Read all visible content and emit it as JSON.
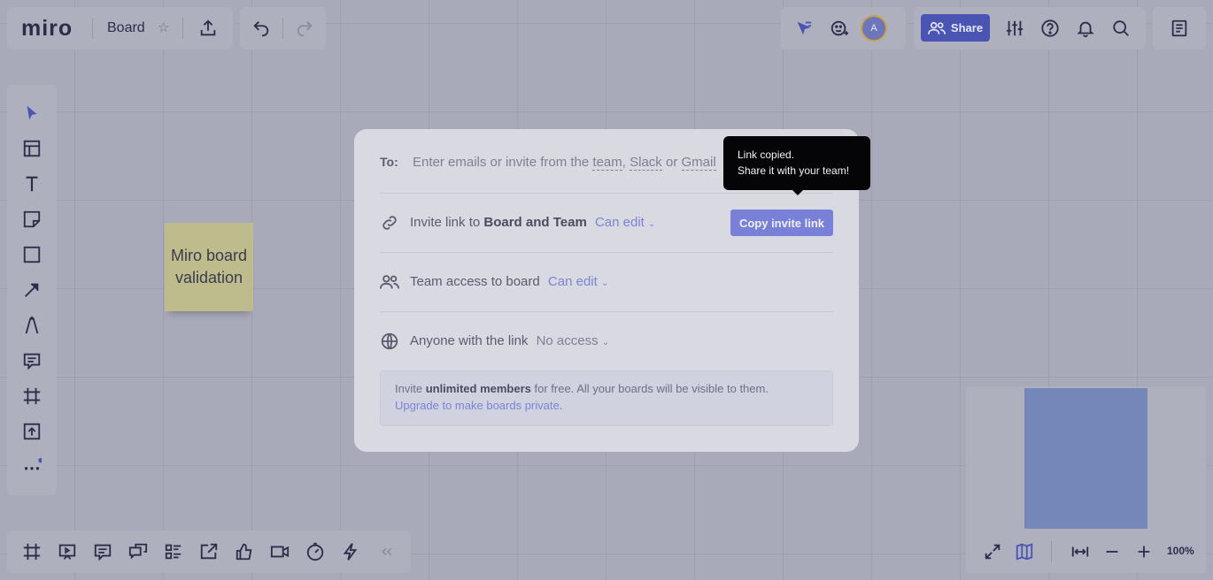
{
  "app": {
    "logo": "miro",
    "board_title": "Board",
    "star_glyph": "☆"
  },
  "toolbar": {
    "share_label": "Share",
    "avatar_initial": "A"
  },
  "left_tools": [
    "select-tool",
    "templates-tool",
    "text-tool",
    "sticky-note-tool",
    "shape-tool",
    "connection-line-tool",
    "pen-tool",
    "comment-tool",
    "frame-tool",
    "upload-tool",
    "more-tools"
  ],
  "sticky_note": {
    "text": "Miro board validation"
  },
  "share_dialog": {
    "to_label": "To:",
    "to_placeholder_prefix": "Enter emails or invite from the ",
    "to_team": "team",
    "to_sep1": ", ",
    "to_slack": "Slack",
    "to_sep2": " or ",
    "to_gmail": "Gmail",
    "invite_link_prefix": "Invite link to ",
    "invite_link_target": "Board and Team",
    "invite_link_permission": "Can edit",
    "copy_button": "Copy invite link",
    "team_access_label": "Team access to board",
    "team_access_permission": "Can edit",
    "anyone_label": "Anyone with the link",
    "anyone_permission": "No access",
    "promo_prefix": "Invite ",
    "promo_bold": "unlimited members",
    "promo_suffix": " for free. All your boards will be visible to them.",
    "promo_link": "Upgrade to make boards private",
    "promo_link_end": "."
  },
  "tooltip": {
    "line1": "Link copied.",
    "line2": "Share it with your team!"
  },
  "bottom_tools": [
    "frames-icon",
    "presentation-icon",
    "comments-icon",
    "chat-icon",
    "card-list-icon",
    "share-screen-icon",
    "voting-icon",
    "video-chat-icon",
    "timer-icon",
    "apps-icon"
  ],
  "zoom": {
    "level": "100%"
  },
  "colors": {
    "accent": "#4a54b3",
    "link": "#7b84d8",
    "canvas": "#a9aab9"
  }
}
